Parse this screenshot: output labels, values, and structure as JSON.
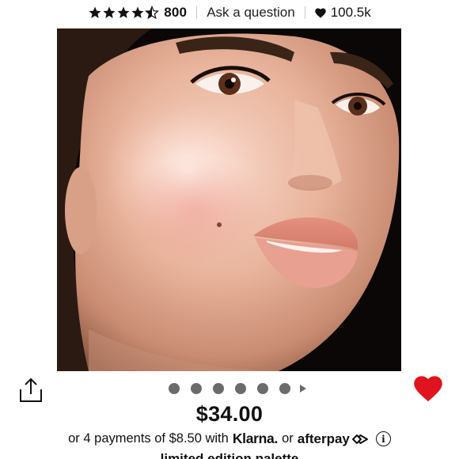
{
  "header": {
    "rating_value": 4.5,
    "rating_count": "800",
    "ask_label": "Ask a question",
    "loves_count": "100.5k"
  },
  "gallery": {
    "image_label": "Model face showcasing highlighter on cheekbone",
    "slide_count": 6,
    "active_slide": 1
  },
  "product": {
    "price": "$34.00",
    "installment_prefix": "or 4 payments of $8.50 with",
    "klarna_label": "Klarna.",
    "or_label": "or",
    "afterpay_label": "afterpay",
    "next_line_partial": "limited edition palette"
  },
  "colors": {
    "love_red": "#e0141e",
    "text": "#111111",
    "dot": "#6b6b6b"
  },
  "icons": [
    "star-icon",
    "heart-icon",
    "share-icon",
    "info-icon",
    "afterpay-logo-icon"
  ]
}
